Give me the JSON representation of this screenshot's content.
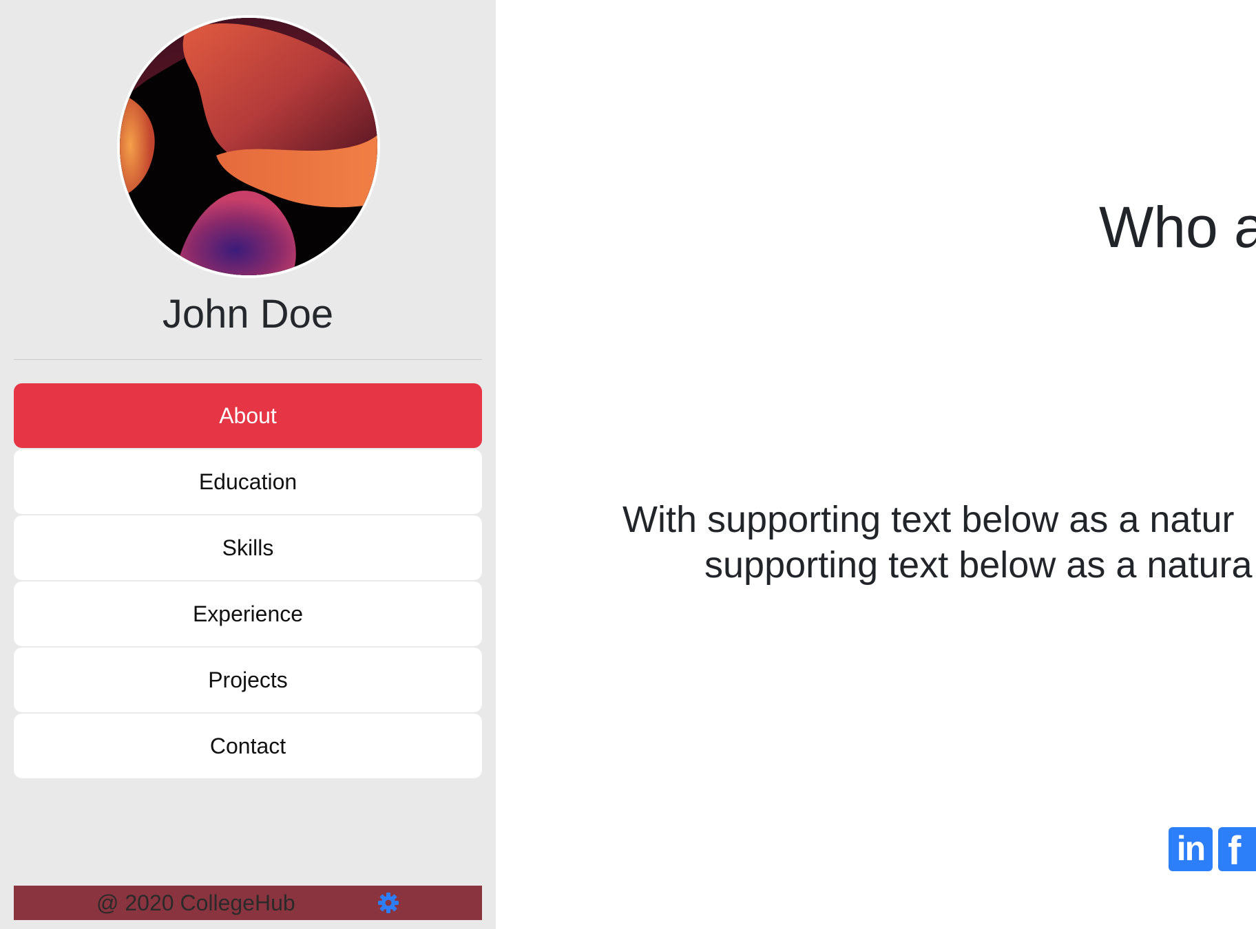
{
  "sidebar": {
    "profile_name": "John Doe",
    "nav_items": [
      {
        "label": "About",
        "active": true
      },
      {
        "label": "Education",
        "active": false
      },
      {
        "label": "Skills",
        "active": false
      },
      {
        "label": "Experience",
        "active": false
      },
      {
        "label": "Projects",
        "active": false
      },
      {
        "label": "Contact",
        "active": false
      }
    ],
    "footer": {
      "text": "@ 2020 CollegeHub",
      "icon": "gear-icon"
    }
  },
  "main": {
    "title": "Who a",
    "text_line1": "With supporting text below as a natur",
    "text_line2": "supporting text below as a natura"
  },
  "social": {
    "linkedin_label": "in",
    "facebook_label": "f"
  },
  "colors": {
    "sidebar_bg": "#e9e9e9",
    "active_nav": "#e63646",
    "footer_bg": "#8a3440",
    "icon_blue": "#2d7ff9",
    "social_blue": "#2d7ff9"
  }
}
